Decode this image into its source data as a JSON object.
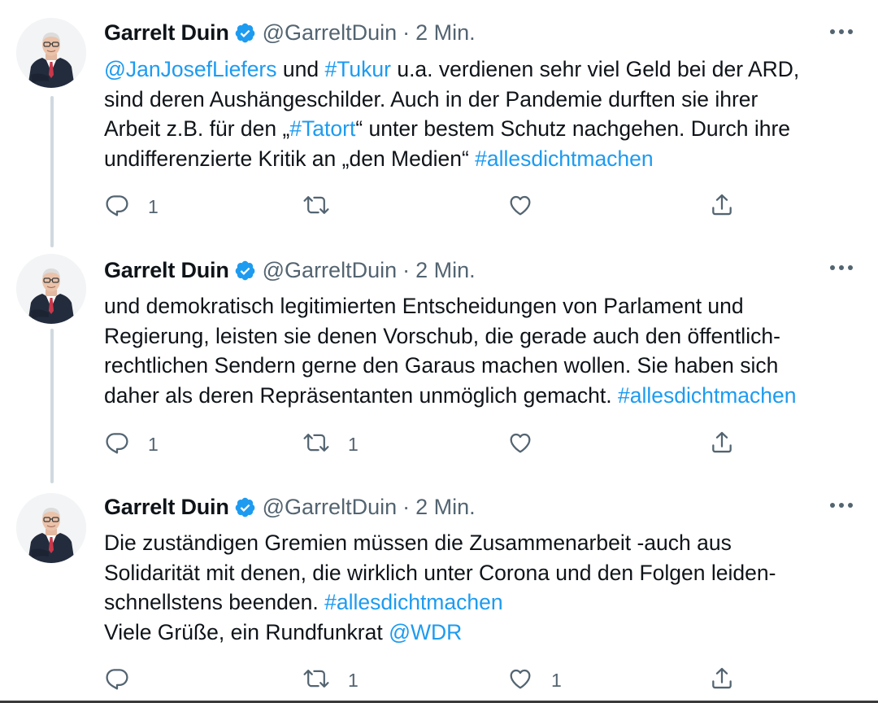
{
  "colors": {
    "link": "#1d9bf0",
    "verified": "#1d9bf0",
    "secondary_text": "#536471",
    "primary_text": "#0f1419",
    "thread_line": "#cfd9de"
  },
  "tweets": [
    {
      "author": {
        "name": "Garrelt Duin",
        "handle": "@GarreltDuin",
        "verified_icon": "verified-badge-icon"
      },
      "separator": "·",
      "time": "2 Min.",
      "text_lines": [
        {
          "segments": [
            {
              "text": "@JanJosefLiefers",
              "type": "link"
            },
            {
              "text": " und ",
              "type": "text"
            },
            {
              "text": "#Tukur",
              "type": "link"
            },
            {
              "text": " u.a. verdienen sehr viel Geld bei der ARD,",
              "type": "text"
            }
          ]
        },
        {
          "segments": [
            {
              "text": "sind deren Aushängeschilder. Auch in der Pandemie durften sie ihrer",
              "type": "text"
            }
          ]
        },
        {
          "segments": [
            {
              "text": "Arbeit z.B. für den „",
              "type": "text"
            },
            {
              "text": "#Tatort",
              "type": "link"
            },
            {
              "text": "“ unter bestem Schutz nachgehen. Durch ihre",
              "type": "text"
            }
          ]
        },
        {
          "segments": [
            {
              "text": "undifferenzierte Kritik an „den Medien“ ",
              "type": "text"
            },
            {
              "text": "#allesdichtmachen",
              "type": "link"
            }
          ]
        }
      ],
      "actions": {
        "reply": {
          "icon": "reply-icon",
          "count": "1"
        },
        "retweet": {
          "icon": "retweet-icon",
          "count": ""
        },
        "like": {
          "icon": "like-icon",
          "count": ""
        },
        "share": {
          "icon": "share-icon",
          "count": ""
        }
      }
    },
    {
      "author": {
        "name": "Garrelt Duin",
        "handle": "@GarreltDuin",
        "verified_icon": "verified-badge-icon"
      },
      "separator": "·",
      "time": "2 Min.",
      "text_lines": [
        {
          "segments": [
            {
              "text": "und demokratisch legitimierten Entscheidungen von Parlament und",
              "type": "text"
            }
          ]
        },
        {
          "segments": [
            {
              "text": "Regierung, leisten sie denen Vorschub, die gerade auch den öffentlich-",
              "type": "text"
            }
          ]
        },
        {
          "segments": [
            {
              "text": "rechtlichen Sendern gerne den Garaus machen wollen. Sie haben sich",
              "type": "text"
            }
          ]
        },
        {
          "segments": [
            {
              "text": "daher als deren Repräsentanten unmöglich gemacht. ",
              "type": "text"
            },
            {
              "text": "#allesdichtmachen",
              "type": "link"
            }
          ]
        }
      ],
      "actions": {
        "reply": {
          "icon": "reply-icon",
          "count": "1"
        },
        "retweet": {
          "icon": "retweet-icon",
          "count": "1"
        },
        "like": {
          "icon": "like-icon",
          "count": ""
        },
        "share": {
          "icon": "share-icon",
          "count": ""
        }
      }
    },
    {
      "author": {
        "name": "Garrelt Duin",
        "handle": "@GarreltDuin",
        "verified_icon": "verified-badge-icon"
      },
      "separator": "·",
      "time": "2 Min.",
      "text_lines": [
        {
          "segments": [
            {
              "text": "Die zuständigen Gremien müssen die Zusammenarbeit -auch aus",
              "type": "text"
            }
          ]
        },
        {
          "segments": [
            {
              "text": "Solidarität mit denen, die wirklich unter Corona und den Folgen leiden-",
              "type": "text"
            }
          ]
        },
        {
          "segments": [
            {
              "text": "schnellstens beenden. ",
              "type": "text"
            },
            {
              "text": "#allesdichtmachen",
              "type": "link"
            }
          ]
        },
        {
          "segments": [
            {
              "text": "Viele Grüße, ein Rundfunkrat ",
              "type": "text"
            },
            {
              "text": "@WDR",
              "type": "link"
            }
          ]
        }
      ],
      "actions": {
        "reply": {
          "icon": "reply-icon",
          "count": ""
        },
        "retweet": {
          "icon": "retweet-icon",
          "count": "1"
        },
        "like": {
          "icon": "like-icon",
          "count": "1"
        },
        "share": {
          "icon": "share-icon",
          "count": ""
        }
      }
    }
  ]
}
